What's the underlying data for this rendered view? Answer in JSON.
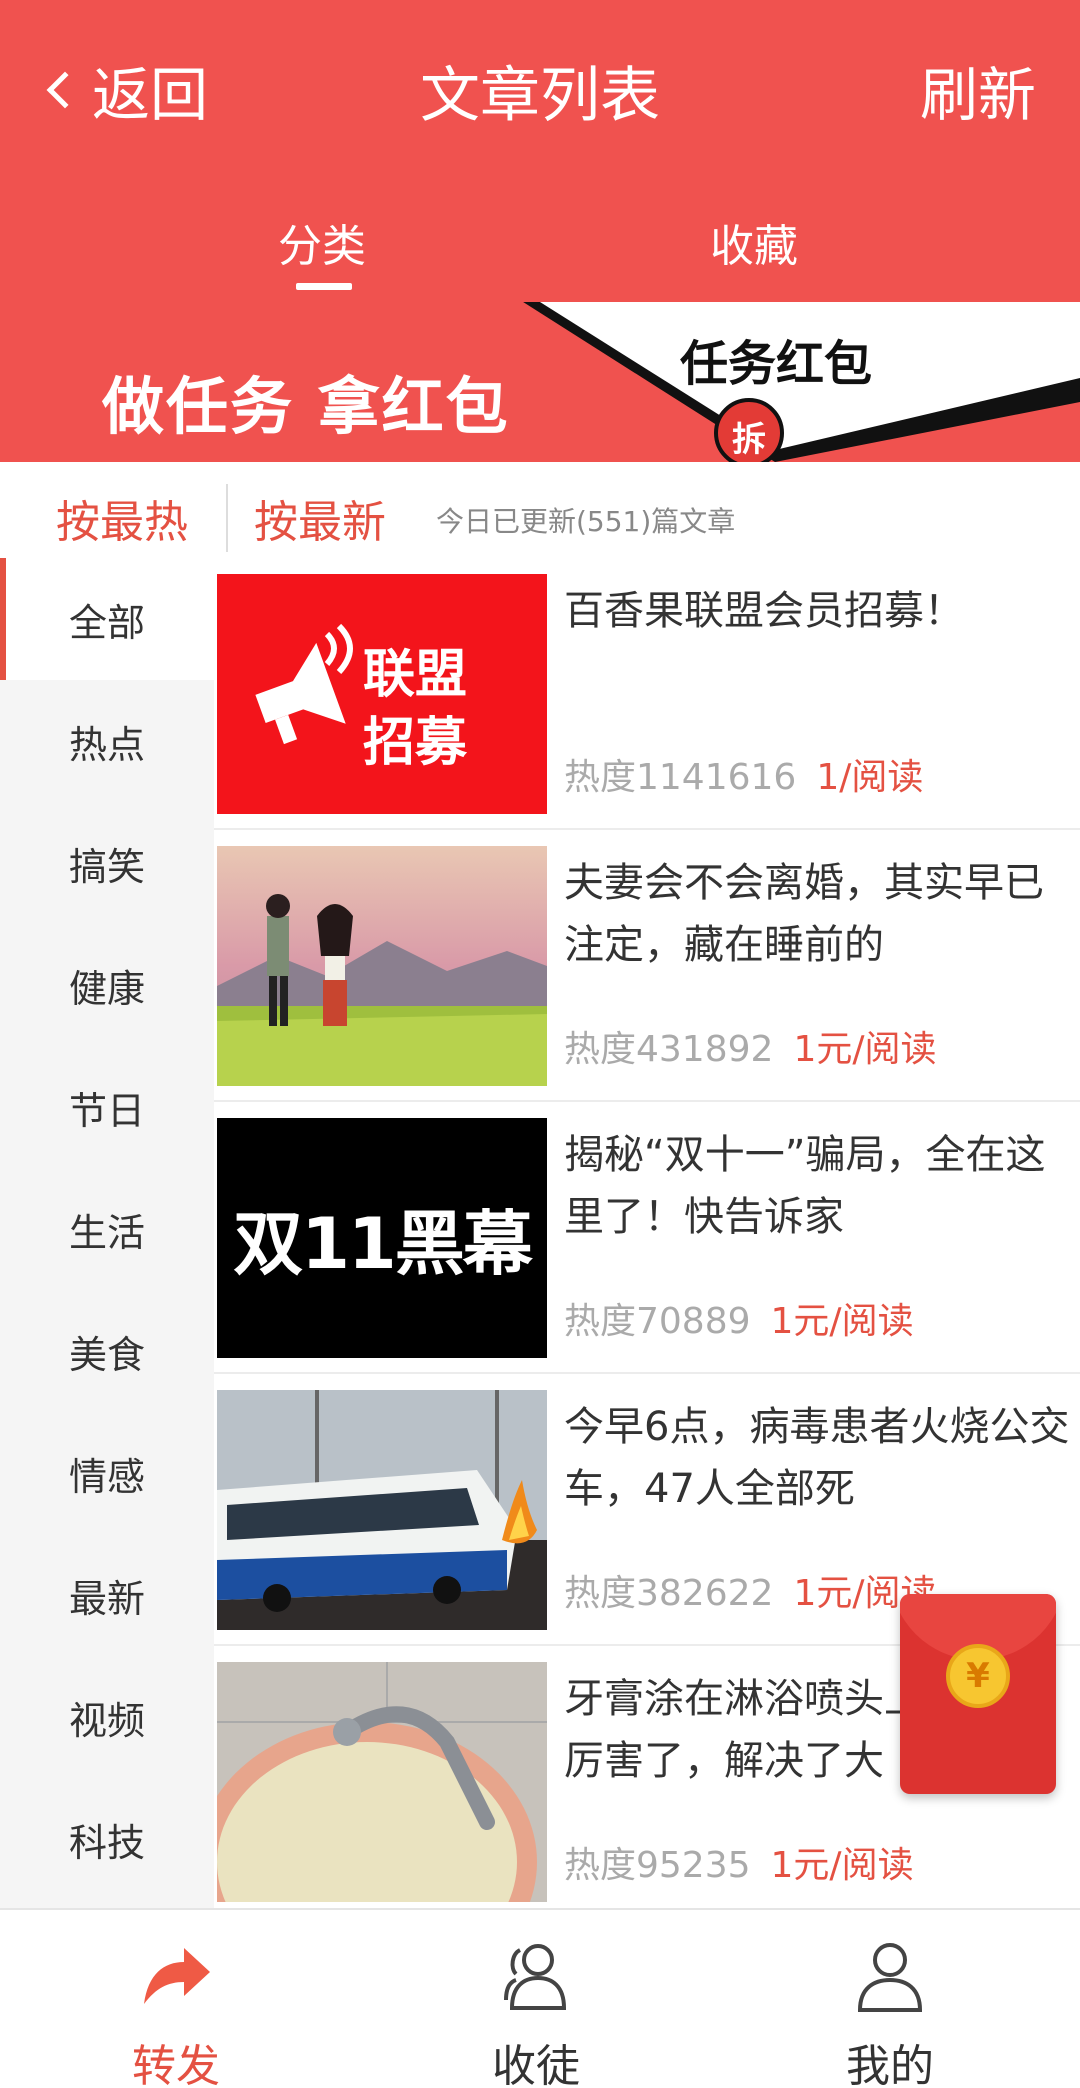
{
  "nav": {
    "back_label": "返回",
    "title": "文章列表",
    "refresh_label": "刷新"
  },
  "tabs": [
    {
      "label": "分类",
      "active": true
    },
    {
      "label": "收藏",
      "active": false
    }
  ],
  "banner": {
    "text": "做任务 拿红包",
    "task_label": "任务红包",
    "seal_char": "拆"
  },
  "sort": {
    "hot_label": "按最热",
    "new_label": "按最新",
    "update_info": "今日已更新(551)篇文章"
  },
  "sidebar": {
    "items": [
      {
        "label": "全部",
        "active": true
      },
      {
        "label": "热点"
      },
      {
        "label": "搞笑"
      },
      {
        "label": "健康"
      },
      {
        "label": "节日"
      },
      {
        "label": "生活"
      },
      {
        "label": "美食"
      },
      {
        "label": "情感"
      },
      {
        "label": "最新"
      },
      {
        "label": "视频"
      },
      {
        "label": "科技"
      }
    ]
  },
  "articles": [
    {
      "title": "百香果联盟会员招募！",
      "heat": "热度1141616",
      "reward": "1/阅读",
      "thumb_text_1": "联盟",
      "thumb_text_2": "招募"
    },
    {
      "title": "夫妻会不会离婚，其实早已注定，藏在睡前的",
      "heat": "热度431892",
      "reward": "1元/阅读"
    },
    {
      "title": "揭秘“双十一”骗局，全在这里了！快告诉家",
      "heat": "热度70889",
      "reward": "1元/阅读",
      "thumb_text": "双11黑幕"
    },
    {
      "title": "今早6点，病毒患者火烧公交车，47人全部死",
      "heat": "热度382622",
      "reward": "1元/阅读"
    },
    {
      "title": "牙膏涂在淋浴喷头上，真是厉害了，解决了大",
      "heat": "热度95235",
      "reward": "1元/阅读"
    }
  ],
  "red_packet": {
    "coin_symbol": "¥"
  },
  "bottom_nav": [
    {
      "label": "转发",
      "icon": "share-arrow-icon",
      "active": true
    },
    {
      "label": "收徒",
      "icon": "users-icon",
      "active": false
    },
    {
      "label": "我的",
      "icon": "user-icon",
      "active": false
    }
  ],
  "colors": {
    "brand_red": "#f0524f",
    "accent_red": "#e45142",
    "gray_text": "#aaaaaa"
  }
}
